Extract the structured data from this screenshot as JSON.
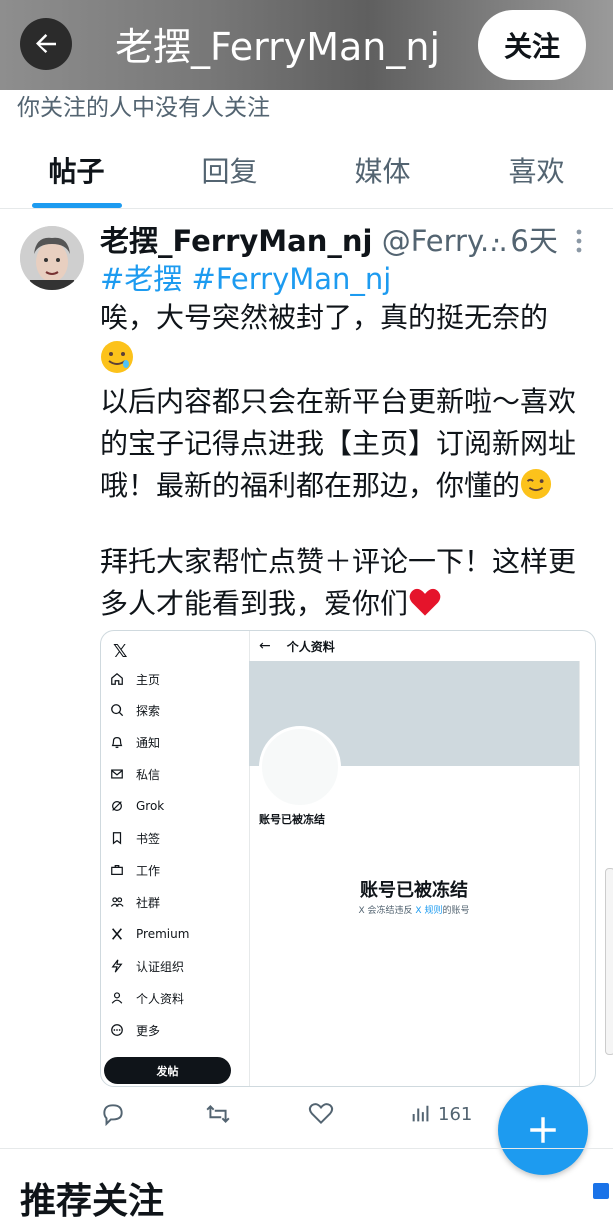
{
  "header": {
    "title": "老摆_FerryMan_nj",
    "follow_label": "关注",
    "note": "你关注的人中没有人关注"
  },
  "tabs": [
    {
      "label": "帖子",
      "active": true
    },
    {
      "label": "回复",
      "active": false
    },
    {
      "label": "媒体",
      "active": false
    },
    {
      "label": "喜欢",
      "active": false
    }
  ],
  "post": {
    "author_name": "老摆_FerryMan_nj",
    "author_handle": "@Ferry...",
    "time": "· 6天",
    "hashtags": "#老摆 #FerryMan_nj",
    "lines": [
      "唉，大号突然被封了，真的挺无奈的",
      "以后内容都只会在新平台更新啦～喜欢",
      "的宝子记得点进我【主页】订阅新网址",
      "哦！最新的福利都在那边，你懂的",
      "拜托大家帮忙点赞＋评论一下！这样更",
      "多人才能看到我，爱你们"
    ]
  },
  "embed": {
    "nav_items": [
      {
        "label": "主页",
        "icon": "home-icon"
      },
      {
        "label": "探索",
        "icon": "search-icon"
      },
      {
        "label": "通知",
        "icon": "bell-icon"
      },
      {
        "label": "私信",
        "icon": "mail-icon"
      },
      {
        "label": "Grok",
        "icon": "grok-icon"
      },
      {
        "label": "书签",
        "icon": "bookmark-icon"
      },
      {
        "label": "工作",
        "icon": "briefcase-icon"
      },
      {
        "label": "社群",
        "icon": "community-icon"
      },
      {
        "label": "Premium",
        "icon": "x-icon"
      },
      {
        "label": "认证组织",
        "icon": "lightning-icon"
      },
      {
        "label": "个人资料",
        "icon": "person-icon"
      },
      {
        "label": "更多",
        "icon": "more-circle-icon"
      }
    ],
    "post_button": "发帖",
    "profile_title": "个人资料",
    "frozen_small": "账号已被冻结",
    "frozen_big": "账号已被冻结",
    "frozen_sub_pre": "X 会冻结违反 ",
    "frozen_sub_link": "X 规则",
    "frozen_sub_post": "的账号"
  },
  "actions": {
    "views": "161"
  },
  "recommend_title": "推荐关注",
  "colors": {
    "accent": "#1d9bf0",
    "text": "#0f1419",
    "secondary": "#536471"
  }
}
